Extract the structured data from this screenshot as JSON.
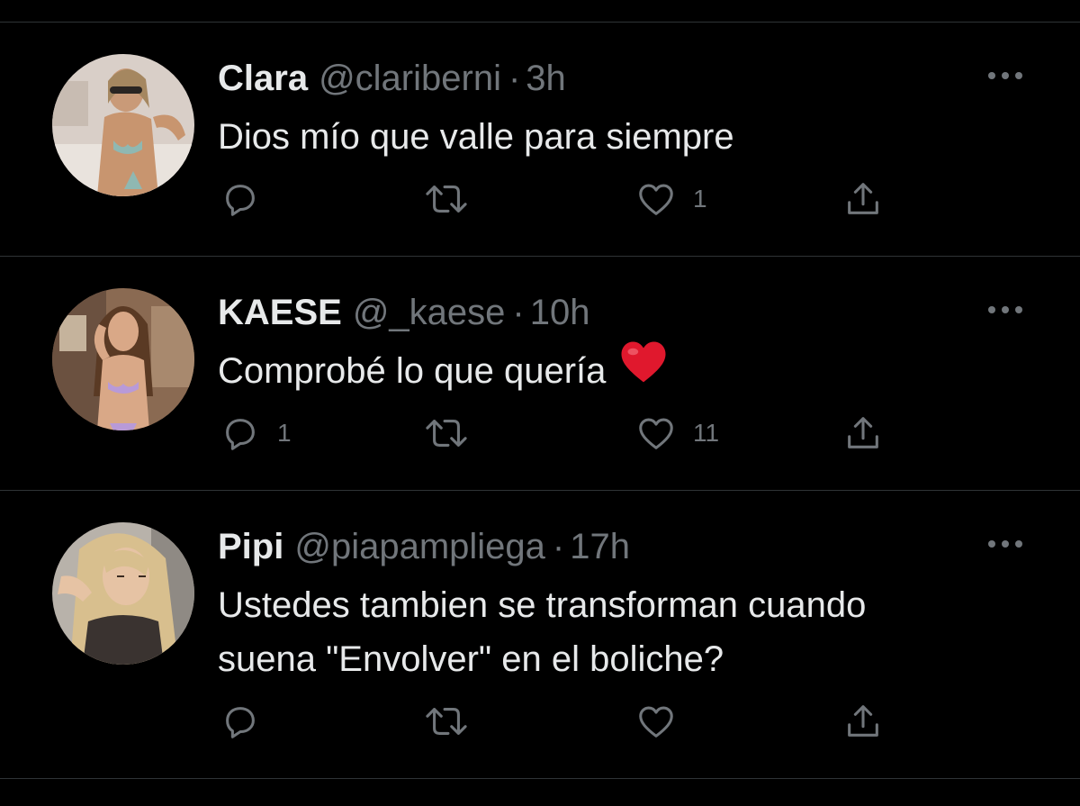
{
  "colors": {
    "background": "#000000",
    "primary_text": "#e7e9ea",
    "secondary_text": "#71767b",
    "divider": "#2f3336",
    "heart_emoji": "#e0182d"
  },
  "tweets": [
    {
      "name": "Clara",
      "handle": "@clariberni",
      "separator": "·",
      "time": "3h",
      "text_lines": [
        "Dios mío que valle para siempre"
      ],
      "emoji": "",
      "reply_count": "",
      "retweet_count": "",
      "like_count": "1",
      "icons": [
        "more-icon",
        "reply-icon",
        "retweet-icon",
        "like-icon",
        "share-icon"
      ]
    },
    {
      "name": "KAESE",
      "handle": "@_kaese",
      "separator": "·",
      "time": "10h",
      "text_lines": [
        "Comprobé lo que quería"
      ],
      "emoji": "red-heart",
      "reply_count": "1",
      "retweet_count": "",
      "like_count": "11",
      "icons": [
        "more-icon",
        "reply-icon",
        "retweet-icon",
        "like-icon",
        "share-icon"
      ]
    },
    {
      "name": "Pipi",
      "handle": "@piapampliega",
      "separator": "·",
      "time": "17h",
      "text_lines": [
        "Ustedes tambien se transforman cuando",
        "suena \"Envolver\" en el boliche?"
      ],
      "emoji": "",
      "reply_count": "",
      "retweet_count": "",
      "like_count": "",
      "icons": [
        "more-icon",
        "reply-icon",
        "retweet-icon",
        "like-icon",
        "share-icon"
      ]
    }
  ]
}
